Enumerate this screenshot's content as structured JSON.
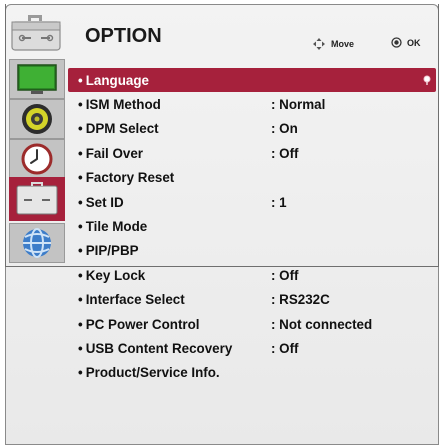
{
  "header": {
    "title": "OPTION",
    "move_label": "Move",
    "ok_label": "OK",
    "icon": "option-toolbox-icon"
  },
  "sidebar": {
    "items": [
      {
        "name": "picture-icon",
        "active": false
      },
      {
        "name": "audio-icon",
        "active": false
      },
      {
        "name": "time-icon",
        "active": false
      },
      {
        "name": "option-icon",
        "active": true
      },
      {
        "name": "network-icon",
        "active": false
      }
    ]
  },
  "menu": {
    "items": [
      {
        "label": "Language",
        "value": ""
      },
      {
        "label": "ISM Method",
        "value": ": Normal"
      },
      {
        "label": "DPM Select",
        "value": ": On"
      },
      {
        "label": "Fail Over",
        "value": ": Off"
      },
      {
        "label": "Factory Reset",
        "value": ""
      },
      {
        "label": "Set ID",
        "value": ": 1"
      },
      {
        "label": "Tile Mode",
        "value": ""
      },
      {
        "label": "PIP/PBP",
        "value": ""
      },
      {
        "label": "Key Lock",
        "value": ": Off"
      },
      {
        "label": "Interface Select",
        "value": ": RS232C"
      },
      {
        "label": "PC Power Control",
        "value": ": Not connected"
      },
      {
        "label": "USB Content Recovery",
        "value": ": Off"
      },
      {
        "label": "Product/Service Info.",
        "value": ""
      }
    ]
  },
  "colors": {
    "selection": "#a6213c",
    "panel": "#efefef"
  }
}
